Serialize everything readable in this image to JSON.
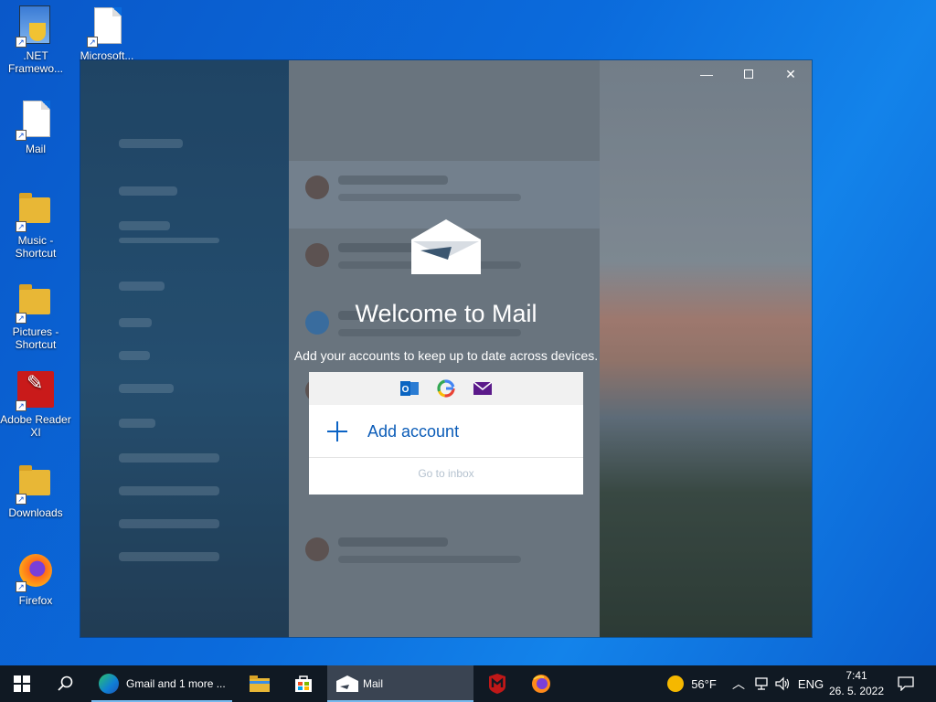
{
  "desktop": {
    "icons": [
      {
        "label": ".NET Framewo...",
        "icon": "dotnet-installer-icon"
      },
      {
        "label": "Microsoft...",
        "icon": "document-icon"
      },
      {
        "label": "Mail",
        "icon": "document-icon"
      },
      {
        "label": "Music - Shortcut",
        "icon": "folder-icon"
      },
      {
        "label": "Pictures - Shortcut",
        "icon": "folder-icon"
      },
      {
        "label": "Adobe Reader XI",
        "icon": "adobe-reader-icon"
      },
      {
        "label": "Downloads",
        "icon": "folder-icon"
      },
      {
        "label": "Firefox",
        "icon": "firefox-icon"
      }
    ]
  },
  "mail_window": {
    "welcome_title": "Welcome to Mail",
    "welcome_subtitle": "Add your accounts to keep up to date across devices.",
    "providers": [
      "outlook-icon",
      "google-icon",
      "yahoo-mail-icon"
    ],
    "add_account_label": "Add account",
    "go_to_inbox_label": "Go to inbox"
  },
  "taskbar": {
    "apps": [
      {
        "label": "Gmail and 1 more ...",
        "icon": "edge-icon"
      },
      {
        "label": "",
        "icon": "file-explorer-icon"
      },
      {
        "label": "",
        "icon": "store-icon"
      },
      {
        "label": "Mail",
        "icon": "mail-icon",
        "active": true
      },
      {
        "label": "",
        "icon": "mcafee-icon"
      },
      {
        "label": "",
        "icon": "firefox-icon"
      }
    ],
    "weather": "56°F",
    "language": "ENG",
    "time": "7:41",
    "date": "26. 5. 2022"
  },
  "colors": {
    "desktop_blue": "#0b6bdc",
    "taskbar": "#101923",
    "accent_link": "#0b5cb8"
  }
}
